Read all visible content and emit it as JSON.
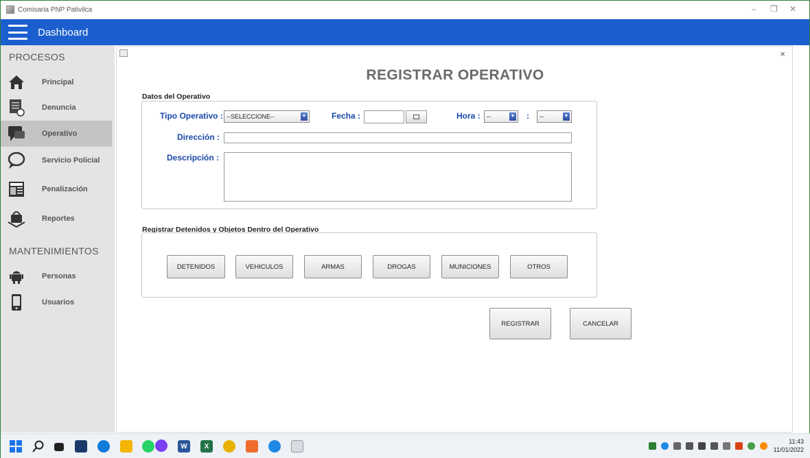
{
  "window": {
    "title": "Comisaria PNP Pativilca",
    "controls": {
      "minimize": "–",
      "restore": "❐",
      "close": "✕"
    }
  },
  "header": {
    "title": "Dashboard"
  },
  "sidebar": {
    "section_procesos": "PROCESOS",
    "section_mantenimientos": "MANTENIMIENTOS",
    "procesos": [
      {
        "label": "Principal",
        "icon": "home-icon"
      },
      {
        "label": "Denuncia",
        "icon": "document-icon"
      },
      {
        "label": "Operativo",
        "icon": "chat-icon",
        "active": true
      },
      {
        "label": "Servicio Policial",
        "icon": "speech-bubble-icon"
      },
      {
        "label": "Penalización",
        "icon": "newspaper-icon"
      },
      {
        "label": "Reportes",
        "icon": "bag-icon"
      }
    ],
    "mantenimientos": [
      {
        "label": "Personas",
        "icon": "android-icon"
      },
      {
        "label": "Usuarios",
        "icon": "phone-icon"
      }
    ]
  },
  "dialog": {
    "close": "×",
    "title": "REGISTRAR OPERATIVO",
    "datos_group": "Datos del Operativo",
    "tipo_label": "Tipo Operativo :",
    "tipo_value": "--SELECCIONE--",
    "fecha_label": "Fecha :",
    "fecha_value": "",
    "hora_label": "Hora :",
    "hora_value": "--",
    "hora_sep": ":",
    "minuto_value": "--",
    "direccion_label": "Dirección :",
    "direccion_value": "",
    "descripcion_label": "Descripción :",
    "descripcion_value": "",
    "registrar_group": "Registrar Detenidos y Objetos Dentro del Operativo",
    "object_buttons": [
      "DETENIDOS",
      "VEHICULOS",
      "ARMAS",
      "DROGAS",
      "MUNICIONES",
      "OTROS"
    ],
    "registrar_button": "REGISTRAR",
    "cancelar_button": "CANCELAR"
  },
  "taskbar": {
    "time": "11:43",
    "date": "11/01/2022"
  },
  "colors": {
    "header_blue": "#1b5fcf",
    "label_blue": "#1a48a8",
    "sidebar_bg": "#e4e4e4",
    "active_item": "#c4c4c4"
  }
}
